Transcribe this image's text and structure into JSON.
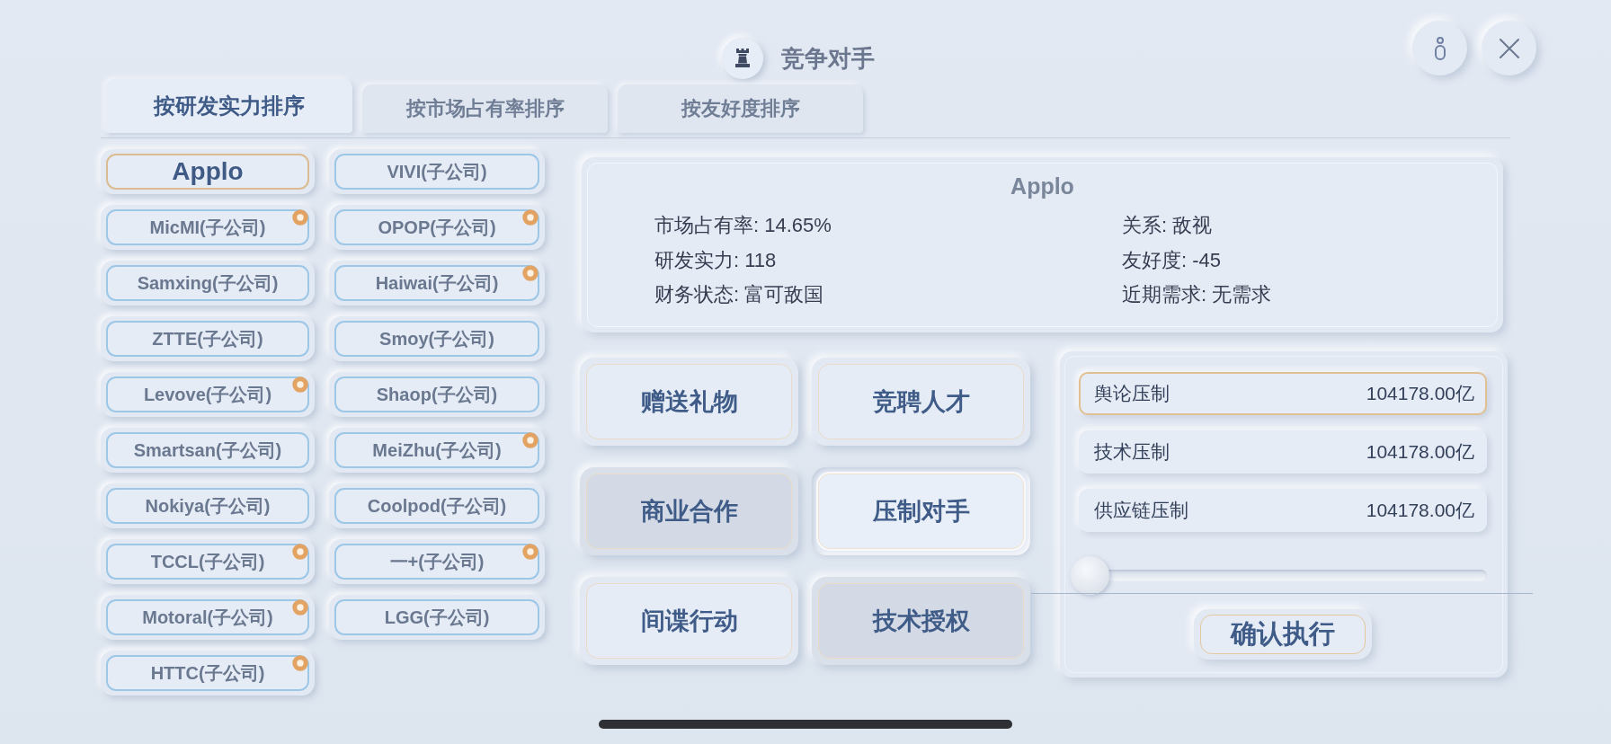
{
  "header": {
    "title": "竞争对手"
  },
  "tabs": [
    {
      "label": "按研发实力排序",
      "selected": true
    },
    {
      "label": "按市场占有率排序",
      "selected": false
    },
    {
      "label": "按友好度排序",
      "selected": false
    }
  ],
  "competitors": [
    {
      "name": "Applo",
      "selected": true,
      "badge": false
    },
    {
      "name": "VIVI(子公司)",
      "selected": false,
      "badge": false
    },
    {
      "name": "MicMI(子公司)",
      "selected": false,
      "badge": true
    },
    {
      "name": "OPOP(子公司)",
      "selected": false,
      "badge": true
    },
    {
      "name": "Samxing(子公司)",
      "selected": false,
      "badge": false
    },
    {
      "name": "Haiwai(子公司)",
      "selected": false,
      "badge": true
    },
    {
      "name": "ZTTE(子公司)",
      "selected": false,
      "badge": false
    },
    {
      "name": "Smoy(子公司)",
      "selected": false,
      "badge": false
    },
    {
      "name": "Levove(子公司)",
      "selected": false,
      "badge": true
    },
    {
      "name": "Shaop(子公司)",
      "selected": false,
      "badge": false
    },
    {
      "name": "Smartsan(子公司)",
      "selected": false,
      "badge": false
    },
    {
      "name": "MeiZhu(子公司)",
      "selected": false,
      "badge": true
    },
    {
      "name": "Nokiya(子公司)",
      "selected": false,
      "badge": false
    },
    {
      "name": "Coolpod(子公司)",
      "selected": false,
      "badge": false
    },
    {
      "name": "TCCL(子公司)",
      "selected": false,
      "badge": true
    },
    {
      "name": "一+(子公司)",
      "selected": false,
      "badge": true
    },
    {
      "name": "Motoral(子公司)",
      "selected": false,
      "badge": true
    },
    {
      "name": "LGG(子公司)",
      "selected": false,
      "badge": false
    },
    {
      "name": "HTTC(子公司)",
      "selected": false,
      "badge": true
    }
  ],
  "detail": {
    "name": "Applo",
    "fields": [
      "市场占有率: 14.65%",
      "关系: 敌视",
      "研发实力: 118",
      "友好度: -45",
      "财务状态: 富可敌国",
      "近期需求: 无需求"
    ]
  },
  "actions": [
    {
      "label": "赠送礼物",
      "selected": false,
      "disabled": false
    },
    {
      "label": "竞聘人才",
      "selected": false,
      "disabled": false
    },
    {
      "label": "商业合作",
      "selected": false,
      "disabled": true
    },
    {
      "label": "压制对手",
      "selected": true,
      "disabled": false
    },
    {
      "label": "间谍行动",
      "selected": false,
      "disabled": false
    },
    {
      "label": "技术授权",
      "selected": false,
      "disabled": true
    }
  ],
  "suppress": {
    "options": [
      {
        "label": "舆论压制",
        "cost": "104178.00亿",
        "selected": true
      },
      {
        "label": "技术压制",
        "cost": "104178.00亿",
        "selected": false
      },
      {
        "label": "供应链压制",
        "cost": "104178.00亿",
        "selected": false
      }
    ],
    "slider": {
      "level": 0
    },
    "confirm": "确认执行"
  }
}
